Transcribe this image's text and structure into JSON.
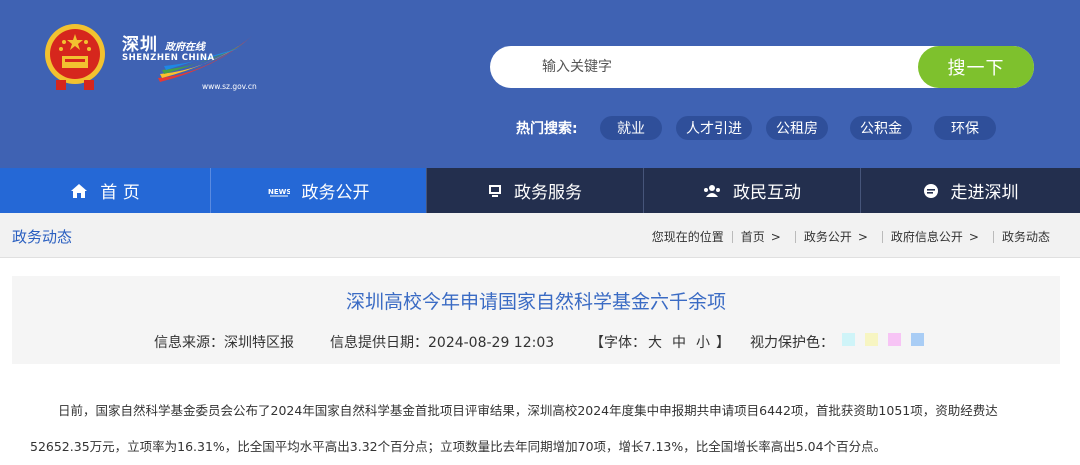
{
  "header": {
    "logo": {
      "cn_main": "深圳",
      "cn_sub": "政府在线",
      "en": "SHENZHEN CHINA",
      "url": "www.sz.gov.cn"
    },
    "search": {
      "placeholder": "输入关键字",
      "button_label": "搜一下"
    },
    "hot_search": {
      "label": "热门搜索:",
      "tags": [
        "就业",
        "人才引进",
        "公租房",
        "公积金",
        "环保"
      ]
    }
  },
  "nav": {
    "items": [
      {
        "label": "首 页",
        "icon": "home-icon"
      },
      {
        "label": "政务公开",
        "icon": "news-icon"
      },
      {
        "label": "政务服务",
        "icon": "monitor-icon"
      },
      {
        "label": "政民互动",
        "icon": "people-icon"
      },
      {
        "label": "走进深圳",
        "icon": "chat-bubble-icon"
      }
    ],
    "active_index": 1
  },
  "breadcrumb_bar": {
    "section_title": "政务动态",
    "location_label": "您现在的位置",
    "crumbs": [
      "首页",
      "政务公开",
      "政府信息公开",
      "政务动态"
    ]
  },
  "article": {
    "title": "深圳高校今年申请国家自然科学基金六千余项",
    "source": "信息来源：深圳特区报",
    "date": "信息提供日期：2024-08-29 12:03",
    "font_label": "【字体：",
    "font_sizes": [
      "大",
      "中",
      "小"
    ],
    "font_close": "】",
    "eye_care_label": "视力保护色：",
    "eye_care_colors": [
      "#cff4f8",
      "#f7f5c2",
      "#f7c4f5",
      "#a9cdf5"
    ],
    "paragraph_1": "日前，国家自然科学基金委员会公布了2024年国家自然科学基金首批项目评审结果，深圳高校2024年度集中申报期共申请项目6442项，首批获资助1051项，资助经费达",
    "paragraph_2": "52652.35万元，立项率为16.31%，比全国平均水平高出3.32个百分点；立项数量比去年同期增加70项，增长7.13%，比全国增长率高出5.04个百分点。"
  },
  "colors": {
    "header_bg": "#3f62b3",
    "nav_bg": "#232f4e",
    "nav_active": "#2568d6",
    "search_btn": "#7ec12d",
    "title_blue": "#3a6bc4"
  }
}
